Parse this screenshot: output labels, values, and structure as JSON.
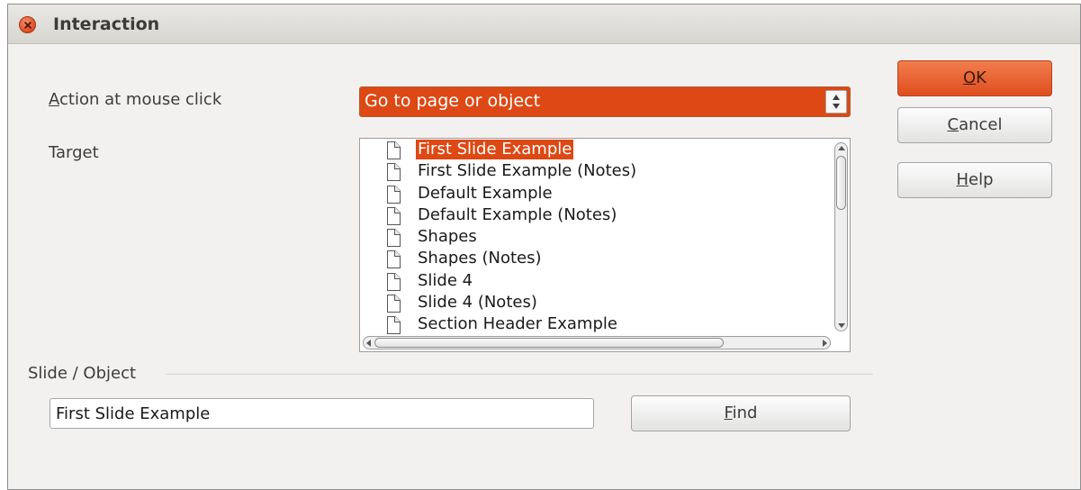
{
  "window": {
    "title": "Interaction"
  },
  "action": {
    "label_mn": "A",
    "label_rest": "ction at mouse click",
    "selected": "Go to page or object"
  },
  "target": {
    "label": "Target",
    "items": [
      "First Slide Example",
      "First Slide Example (Notes)",
      "Default Example",
      "Default Example (Notes)",
      "Shapes",
      "Shapes (Notes)",
      "Slide 4",
      "Slide 4 (Notes)",
      "Section Header Example"
    ],
    "selected_index": 0
  },
  "slide_object": {
    "label": "Slide / Object",
    "value": "First Slide Example"
  },
  "buttons": {
    "ok_mn": "O",
    "ok_rest": "K",
    "cancel_mn": "C",
    "cancel_rest": "ancel",
    "help_mn": "H",
    "help_rest": "elp",
    "find_mn": "F",
    "find_rest": "ind"
  },
  "colors": {
    "accent": "#dd4814"
  }
}
